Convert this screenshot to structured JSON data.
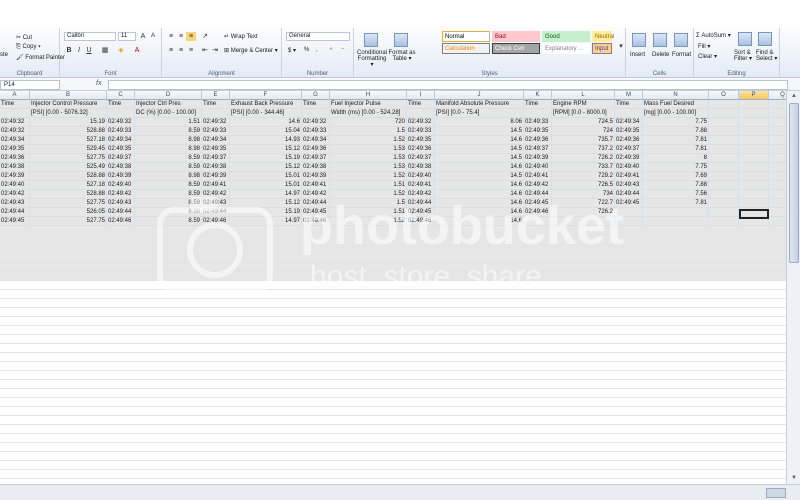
{
  "ribbon": {
    "clipboard": {
      "cut": "Cut",
      "copy": "Copy ▾",
      "format_painter": "Format Painter",
      "paste_label": "ste",
      "group_label": "Clipboard"
    },
    "font": {
      "name": "Calibri",
      "size": "11",
      "group_label": "Font"
    },
    "alignment": {
      "wrap_text": "Wrap Text",
      "merge_center": "Merge & Center ▾",
      "group_label": "Alignment"
    },
    "number": {
      "format": "General",
      "currency": "$ ▾",
      "percent": "%",
      "comma": ",",
      "group_label": "Number"
    },
    "styles": {
      "conditional": "Conditional Formatting ▾",
      "format_table": "Format as Table ▾",
      "cells": [
        {
          "label": "Normal",
          "bg": "#ffffff",
          "fg": "#000000",
          "border": "#e0b24d"
        },
        {
          "label": "Bad",
          "bg": "#ffc7ce",
          "fg": "#9c0006",
          "border": "#ffc7ce"
        },
        {
          "label": "Good",
          "bg": "#c6efce",
          "fg": "#006100",
          "border": "#c6efce"
        },
        {
          "label": "Neutral",
          "bg": "#ffeb9c",
          "fg": "#9c6500",
          "border": "#ffeb9c"
        },
        {
          "label": "Calculation",
          "bg": "#f2f2f2",
          "fg": "#fa7d00",
          "border": "#7f7f7f"
        },
        {
          "label": "Check Cell",
          "bg": "#a5a5a5",
          "fg": "#ffffff",
          "border": "#3f3f3f"
        },
        {
          "label": "Explanatory ...",
          "bg": "#ffffff",
          "fg": "#7f7f7f",
          "border": "#ffffff"
        },
        {
          "label": "Input",
          "bg": "#ffcc99",
          "fg": "#3f3f76",
          "border": "#7f7f7f"
        }
      ],
      "group_label": "Styles"
    },
    "cells": {
      "insert": "Insert",
      "delete": "Delete",
      "format": "Format",
      "group_label": "Cells"
    },
    "editing": {
      "autosum": "Σ AutoSum ▾",
      "fill": "Fill ▾",
      "clear": "Clear ▾",
      "sort": "Sort & Filter ▾",
      "find": "Find & Select ▾",
      "group_label": "Editing"
    }
  },
  "formula_bar": {
    "name_box": "P14",
    "fx": "fx",
    "content": ""
  },
  "columns": [
    "A",
    "B",
    "C",
    "D",
    "E",
    "F",
    "G",
    "H",
    "I",
    "J",
    "K",
    "L",
    "M",
    "N",
    "O",
    "P",
    "Q"
  ],
  "selected_column": "P",
  "sheet": {
    "header_row": [
      "Time",
      "Injector Control Pressure",
      "Time",
      "Injector Ctrl Pres",
      "Time",
      "Exhaust Back Pressure",
      "Time",
      "Fuel Injector Pulse",
      "Time",
      "Manifold Absolute Pressure",
      "Time",
      "Engine RPM",
      "Time",
      "Mass Fuel Desired",
      "",
      "",
      ""
    ],
    "units_row": [
      "",
      "[PSI] [0.00 - 5076.32]",
      "",
      "DC (%) [0.00 - 100.00]",
      "",
      "[PSI] [0.00 - 344.46]",
      "",
      "Width (ms) [0.00 - 524.28]",
      "",
      "[PSI] [0.0 - 75.4]",
      "",
      "[RPM] [0.0 - 8000.0]",
      "",
      "[mg] [0.00 - 100.00]",
      "",
      "",
      ""
    ],
    "data_rows": [
      [
        "02:49:32",
        "15.19",
        "02:49:32",
        "1.51",
        "02:49:32",
        "14.6",
        "02:49:32",
        "720",
        "02:49:32",
        "8.06",
        "02:49:33",
        "724.5",
        "02:49:34",
        "7.75",
        "",
        "",
        ""
      ],
      [
        "02:49:32",
        "528.88",
        "02:49:33",
        "8.59",
        "02:49:33",
        "15.04",
        "02:49:33",
        "1.5",
        "02:49:33",
        "14.5",
        "02:49:35",
        "724",
        "02:49:35",
        "7.88",
        "",
        "",
        ""
      ],
      [
        "02:49:34",
        "527.18",
        "02:49:34",
        "8.98",
        "02:49:34",
        "14.93",
        "02:49:34",
        "1.52",
        "02:49:35",
        "14.6",
        "02:49:36",
        "735.7",
        "02:49:36",
        "7.81",
        "",
        "",
        ""
      ],
      [
        "02:49:35",
        "529.45",
        "02:49:35",
        "8.98",
        "02:49:35",
        "15.12",
        "02:49:36",
        "1.53",
        "02:49:36",
        "14.5",
        "02:49:37",
        "737.2",
        "02:49:37",
        "7.81",
        "",
        "",
        ""
      ],
      [
        "02:49:36",
        "527.75",
        "02:49:37",
        "8.59",
        "02:49:37",
        "15.19",
        "02:49:37",
        "1.53",
        "02:49:37",
        "14.5",
        "02:49:39",
        "726.2",
        "02:49:39",
        "8",
        "",
        "",
        ""
      ],
      [
        "02:49:38",
        "525.49",
        "02:49:38",
        "8.59",
        "02:49:38",
        "15.12",
        "02:49:38",
        "1.53",
        "02:49:38",
        "14.6",
        "02:49:40",
        "733.7",
        "02:49:40",
        "7.75",
        "",
        "",
        ""
      ],
      [
        "02:49:39",
        "528.88",
        "02:49:39",
        "8.98",
        "02:49:39",
        "15.01",
        "02:49:39",
        "1.52",
        "02:49:40",
        "14.5",
        "02:49:41",
        "729.2",
        "02:49:41",
        "7.69",
        "",
        "",
        ""
      ],
      [
        "02:49:40",
        "527.18",
        "02:49:40",
        "8.59",
        "02:49:41",
        "15.01",
        "02:49:41",
        "1.51",
        "02:49:41",
        "14.6",
        "02:49:42",
        "726.5",
        "02:49:43",
        "7.88",
        "",
        "",
        ""
      ],
      [
        "02:49:42",
        "528.88",
        "02:49:42",
        "8.59",
        "02:49:42",
        "14.97",
        "02:49:42",
        "1.52",
        "02:49:42",
        "14.6",
        "02:49:44",
        "734",
        "02:49:44",
        "7.56",
        "",
        "",
        ""
      ],
      [
        "02:49:43",
        "527.75",
        "02:49:43",
        "8.59",
        "02:49:43",
        "15.12",
        "02:49:44",
        "1.5",
        "02:49:44",
        "14.6",
        "02:49:45",
        "722.7",
        "02:49:45",
        "7.81",
        "",
        "",
        ""
      ],
      [
        "02:49:44",
        "526.05",
        "02:49:44",
        "8.98",
        "02:49:44",
        "15.19",
        "02:49:45",
        "1.51",
        "02:49:45",
        "14.6",
        "02:49:46",
        "726.2",
        "",
        "",
        "",
        "",
        ""
      ],
      [
        "02:49:45",
        "527.75",
        "02:49:46",
        "8.59",
        "02:49:46",
        "14.97",
        "02:49:46",
        "1.52",
        "02:49:46",
        "14.6",
        "",
        "",
        "",
        "",
        "",
        "",
        ""
      ]
    ]
  },
  "watermark": {
    "line1": "photobucket",
    "line2": "host. store. share."
  }
}
